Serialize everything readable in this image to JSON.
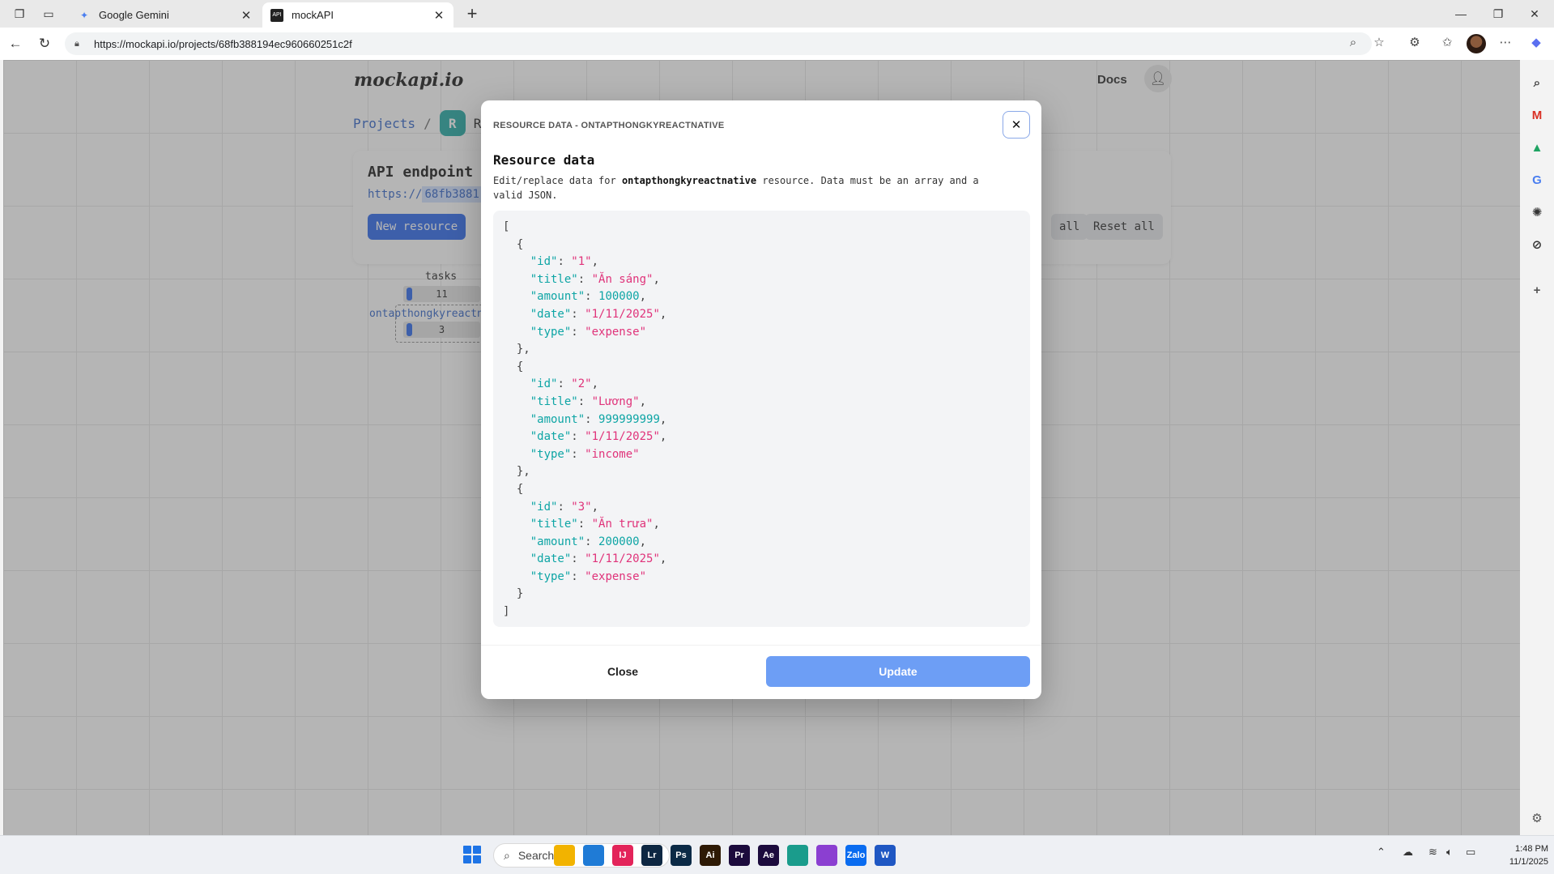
{
  "browser": {
    "tabs": [
      {
        "title": "Google Gemini",
        "icon": "gemini-icon"
      },
      {
        "title": "mockAPI",
        "icon": "mockapi-icon"
      }
    ],
    "url": "https://mockapi.io/projects/68fb388194ec960660251c2f"
  },
  "page": {
    "logo": "mockapi.io",
    "docs": "Docs",
    "breadcrumb": {
      "projects": "Projects",
      "separator": "/",
      "badge": "R",
      "project": "Re"
    },
    "endpoint": {
      "title": "API endpoint",
      "url_prefix": "https://",
      "url_highlight": "68fb3881",
      "new_resource": "New resource",
      "generate_all": "all",
      "reset_all": "Reset all"
    },
    "resources": [
      {
        "name": "tasks",
        "count": "11"
      },
      {
        "name": "ontapthongkyreactn",
        "count": "3"
      }
    ]
  },
  "modal": {
    "caption": "RESOURCE DATA - ONTAPTHONGKYREACTNATIVE",
    "title": "Resource data",
    "desc_prefix": "Edit/replace data for ",
    "desc_resource": "ontapthongkyreactnative",
    "desc_suffix": " resource. Data must be an array and a valid JSON.",
    "records": [
      {
        "id": "1",
        "title": "Ăn sáng",
        "amount": "100000",
        "date": "1/11/2025",
        "type": "expense"
      },
      {
        "id": "2",
        "title": "Lương",
        "amount": "999999999",
        "date": "1/11/2025",
        "type": "income"
      },
      {
        "id": "3",
        "title": "Ăn trưa",
        "amount": "200000",
        "date": "1/11/2025",
        "type": "expense"
      }
    ],
    "close_label": "Close",
    "update_label": "Update"
  },
  "taskbar": {
    "search_placeholder": "Search",
    "time": "1:48 PM",
    "date": "11/1/2025",
    "apps": [
      {
        "name": "file-explorer",
        "label": "",
        "color": "#f2b300"
      },
      {
        "name": "vscode",
        "label": "",
        "color": "#1f7bd6"
      },
      {
        "name": "intellij",
        "label": "IJ",
        "color": "#e3245a"
      },
      {
        "name": "lightroom",
        "label": "Lr",
        "color": "#0e2742"
      },
      {
        "name": "photoshop",
        "label": "Ps",
        "color": "#0b2a46"
      },
      {
        "name": "illustrator",
        "label": "Ai",
        "color": "#2e1a05"
      },
      {
        "name": "premiere",
        "label": "Pr",
        "color": "#1c0b3d"
      },
      {
        "name": "after-effects",
        "label": "Ae",
        "color": "#1c0b3d"
      },
      {
        "name": "edge",
        "label": "",
        "color": "#1a9c8c"
      },
      {
        "name": "app-purple",
        "label": "",
        "color": "#8b3fd1"
      },
      {
        "name": "zalo",
        "label": "Zalo",
        "color": "#0a6cf0"
      },
      {
        "name": "word",
        "label": "W",
        "color": "#1f57c3"
      }
    ]
  },
  "colors": {
    "accent": "#2563eb",
    "json_key": "#0ea5a5",
    "json_string": "#e0337a",
    "update_button": "#6d9ef5"
  }
}
